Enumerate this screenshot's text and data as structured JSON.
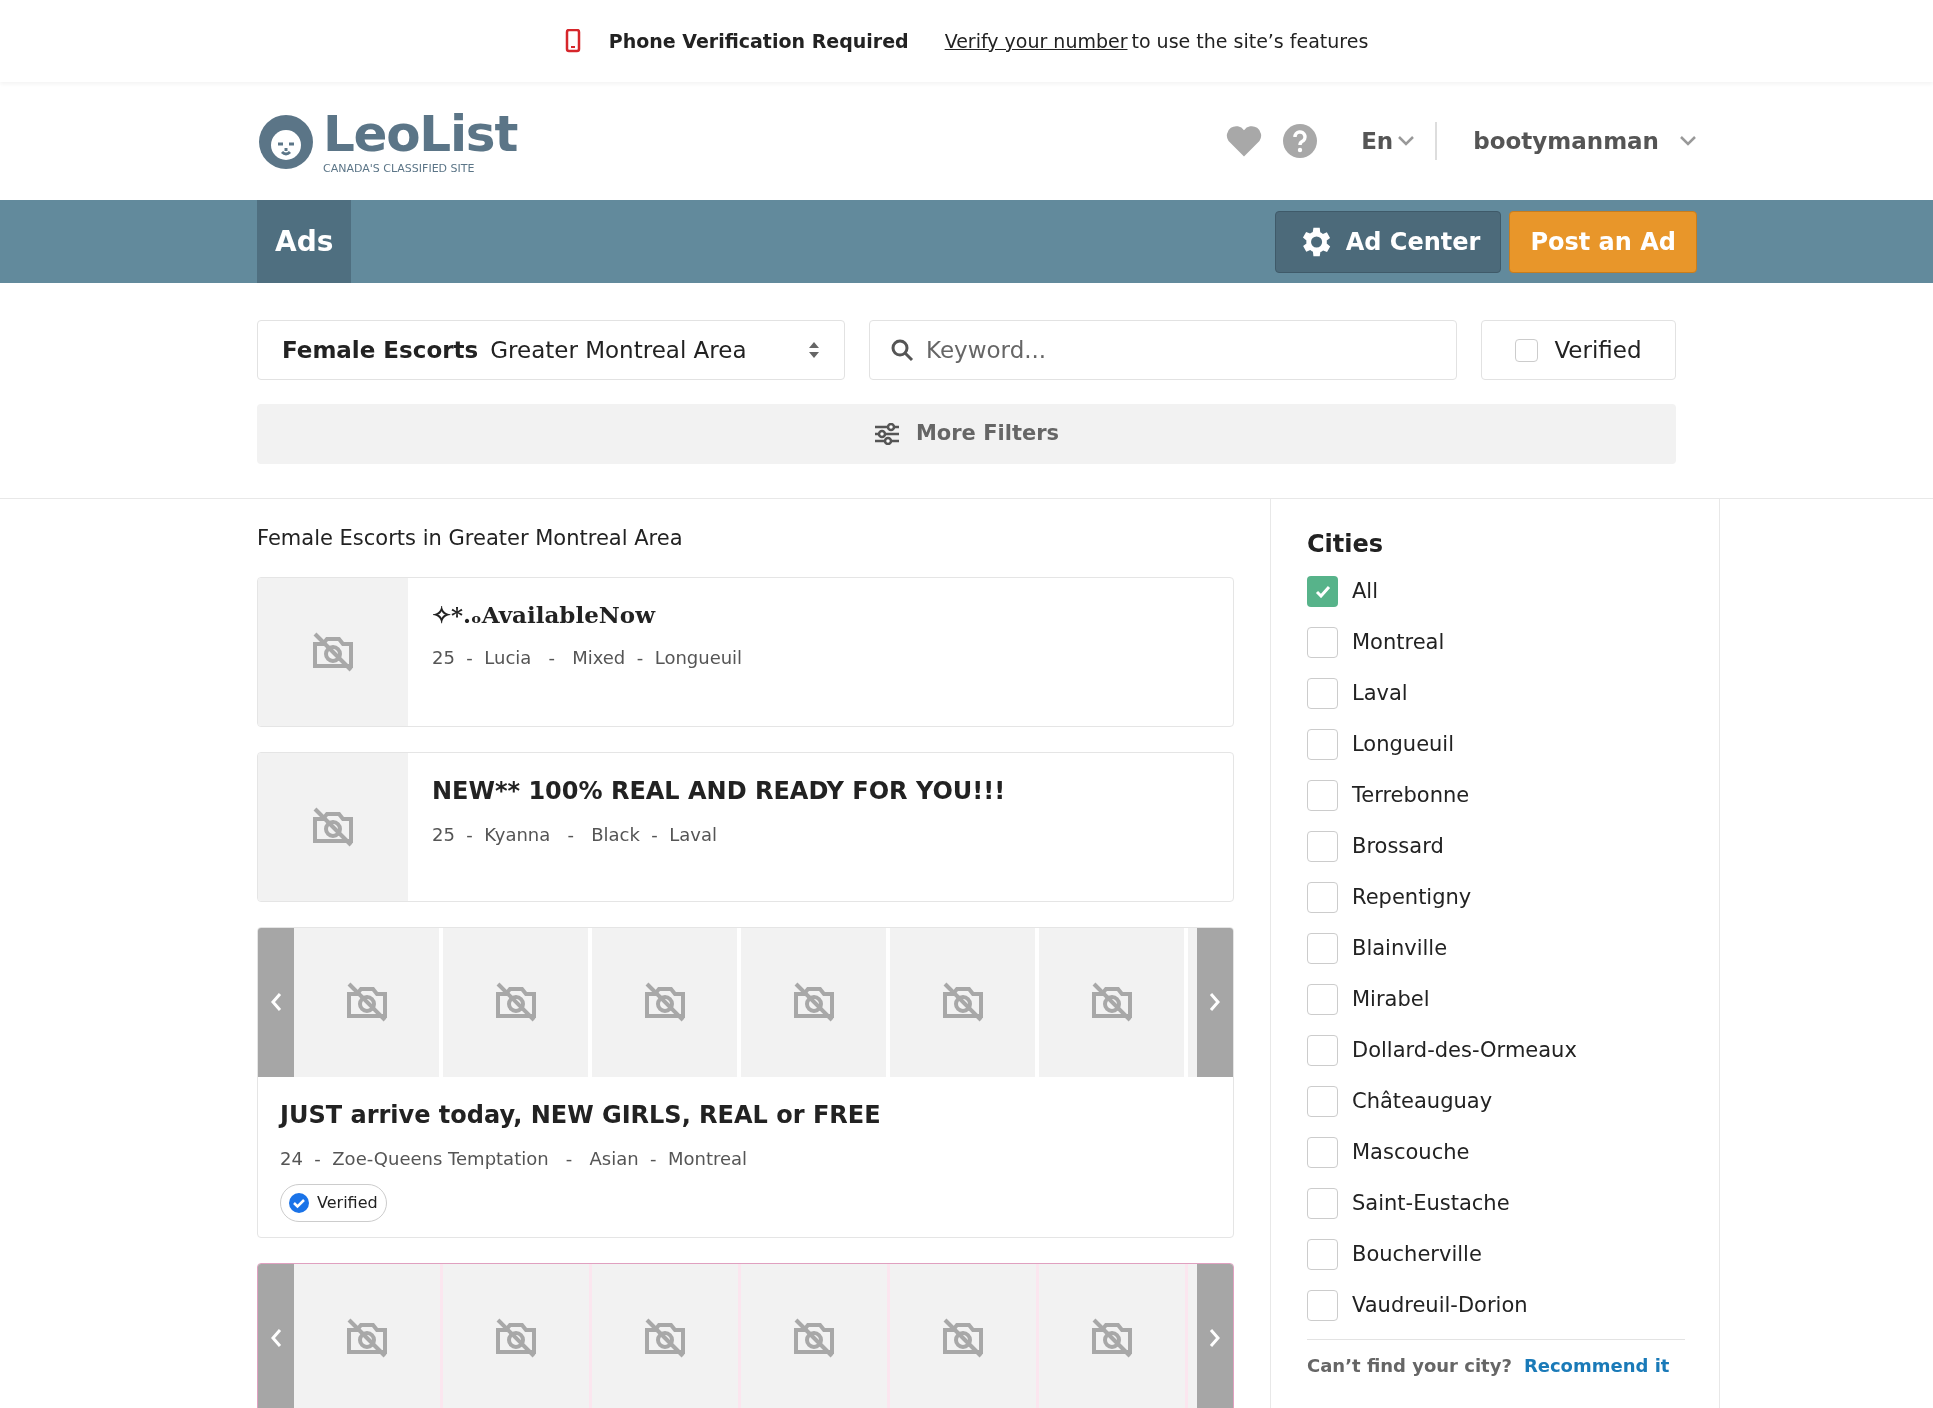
{
  "banner": {
    "title": "Phone Verification Required",
    "link": "Verify your number",
    "text": "to use the site’s features"
  },
  "header": {
    "logo_text": "LeoList",
    "logo_tagline": "CANADA'S CLASSIFIED SITE",
    "language": "En",
    "username": "bootymanman"
  },
  "nav": {
    "tabs": [
      {
        "label": "Ads",
        "selected": true
      }
    ],
    "ad_center": "Ad Center",
    "post_ad": "Post an Ad"
  },
  "filters": {
    "category": "Female Escorts",
    "location": "Greater Montreal Area",
    "keyword_placeholder": "Keyword...",
    "verified": {
      "label": "Verified",
      "checked": false
    },
    "more_filters": "More Filters"
  },
  "listing_heading": "Female Escorts in Greater Montreal Area",
  "ads": [
    {
      "kind": "single",
      "title": "✧*.ₒAvailableNow",
      "meta": "25  -  Lucia   -   Mixed  -  Longueuil",
      "featured": false
    },
    {
      "kind": "single",
      "title": "NEW** 100% REAL AND READY FOR YOU!!!",
      "meta": "25  -  Kyanna   -   Black  -  Laval",
      "featured": false
    },
    {
      "kind": "gallery",
      "title": "JUST arrive today, NEW GIRLS, REAL or FREE",
      "meta": "24  -  Zoe-Queens Temptation   -   Asian  -  Montreal",
      "badge": "Verified",
      "featured": false
    },
    {
      "kind": "gallery",
      "featured": true
    }
  ],
  "cities": {
    "title": "Cities",
    "items": [
      {
        "label": "All",
        "checked": true
      },
      {
        "label": "Montreal",
        "checked": false
      },
      {
        "label": "Laval",
        "checked": false
      },
      {
        "label": "Longueuil",
        "checked": false
      },
      {
        "label": "Terrebonne",
        "checked": false
      },
      {
        "label": "Brossard",
        "checked": false
      },
      {
        "label": "Repentigny",
        "checked": false
      },
      {
        "label": "Blainville",
        "checked": false
      },
      {
        "label": "Mirabel",
        "checked": false
      },
      {
        "label": "Dollard-des-Ormeaux",
        "checked": false
      },
      {
        "label": "Châteauguay",
        "checked": false
      },
      {
        "label": "Mascouche",
        "checked": false
      },
      {
        "label": "Saint-Eustache",
        "checked": false
      },
      {
        "label": "Boucherville",
        "checked": false
      },
      {
        "label": "Vaudreuil-Dorion",
        "checked": false
      }
    ],
    "footer_question": "Can’t find your city?",
    "footer_link": "Recommend it"
  }
}
